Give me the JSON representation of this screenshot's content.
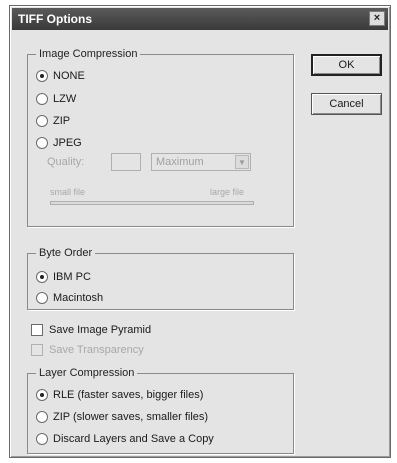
{
  "window": {
    "title": "TIFF Options",
    "close_glyph": "×"
  },
  "buttons": {
    "ok": "OK",
    "cancel": "Cancel"
  },
  "image_compression": {
    "label": "Image Compression",
    "options": [
      {
        "label": "NONE",
        "selected": true
      },
      {
        "label": "LZW",
        "selected": false
      },
      {
        "label": "ZIP",
        "selected": false
      },
      {
        "label": "JPEG",
        "selected": false
      }
    ],
    "quality": {
      "label": "Quality:",
      "value": "",
      "preset": "Maximum",
      "slider_left": "small file",
      "slider_right": "large file",
      "enabled": false
    }
  },
  "byte_order": {
    "label": "Byte Order",
    "options": [
      {
        "label": "IBM PC",
        "selected": true
      },
      {
        "label": "Macintosh",
        "selected": false
      }
    ]
  },
  "checkboxes": [
    {
      "label": "Save Image Pyramid",
      "checked": false,
      "enabled": true
    },
    {
      "label": "Save Transparency",
      "checked": false,
      "enabled": false
    }
  ],
  "layer_compression": {
    "label": "Layer Compression",
    "options": [
      {
        "label": "RLE (faster saves, bigger files)",
        "selected": true
      },
      {
        "label": "ZIP (slower saves, smaller files)",
        "selected": false
      },
      {
        "label": "Discard Layers and Save a Copy",
        "selected": false
      }
    ]
  }
}
